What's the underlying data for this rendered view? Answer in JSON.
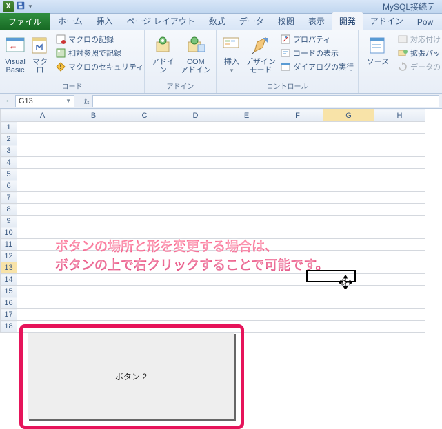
{
  "titlebar": {
    "doc_title": "MySQL接続テ"
  },
  "tabs": {
    "file": "ファイル",
    "items": [
      "ホーム",
      "挿入",
      "ページ レイアウト",
      "数式",
      "データ",
      "校閲",
      "表示",
      "開発",
      "アドイン",
      "Pow"
    ],
    "active_index": 7
  },
  "ribbon": {
    "group_code": {
      "vb": "Visual Basic",
      "macro": "マクロ",
      "rec": "マクロの記録",
      "relref": "相対参照で記録",
      "sec": "マクロのセキュリティ",
      "label": "コード"
    },
    "group_addin": {
      "addin": "アドイン",
      "com": "COM\nアドイン",
      "label": "アドイン"
    },
    "group_ctrl": {
      "insert": "挿入",
      "design": "デザイン\nモード",
      "prop": "プロパティ",
      "viewcode": "コードの表示",
      "dialog": "ダイアログの実行",
      "label": "コントロール"
    },
    "group_xml": {
      "source": "ソース",
      "mapprop": "対応付け",
      "exp": "拡張パッ",
      "refresh": "データの",
      "label": ""
    }
  },
  "namebox": {
    "ref": "G13"
  },
  "columns": [
    "A",
    "B",
    "C",
    "D",
    "E",
    "F",
    "G",
    "H"
  ],
  "rows_count": 18,
  "annotation": {
    "line1": "ボタンの場所と形を変更する場合は、",
    "line2": "ボタンの上で右クリックすることで可能です。"
  },
  "form_button_label": "ボタン 2",
  "active_cell": {
    "col": "G",
    "row": 13
  }
}
